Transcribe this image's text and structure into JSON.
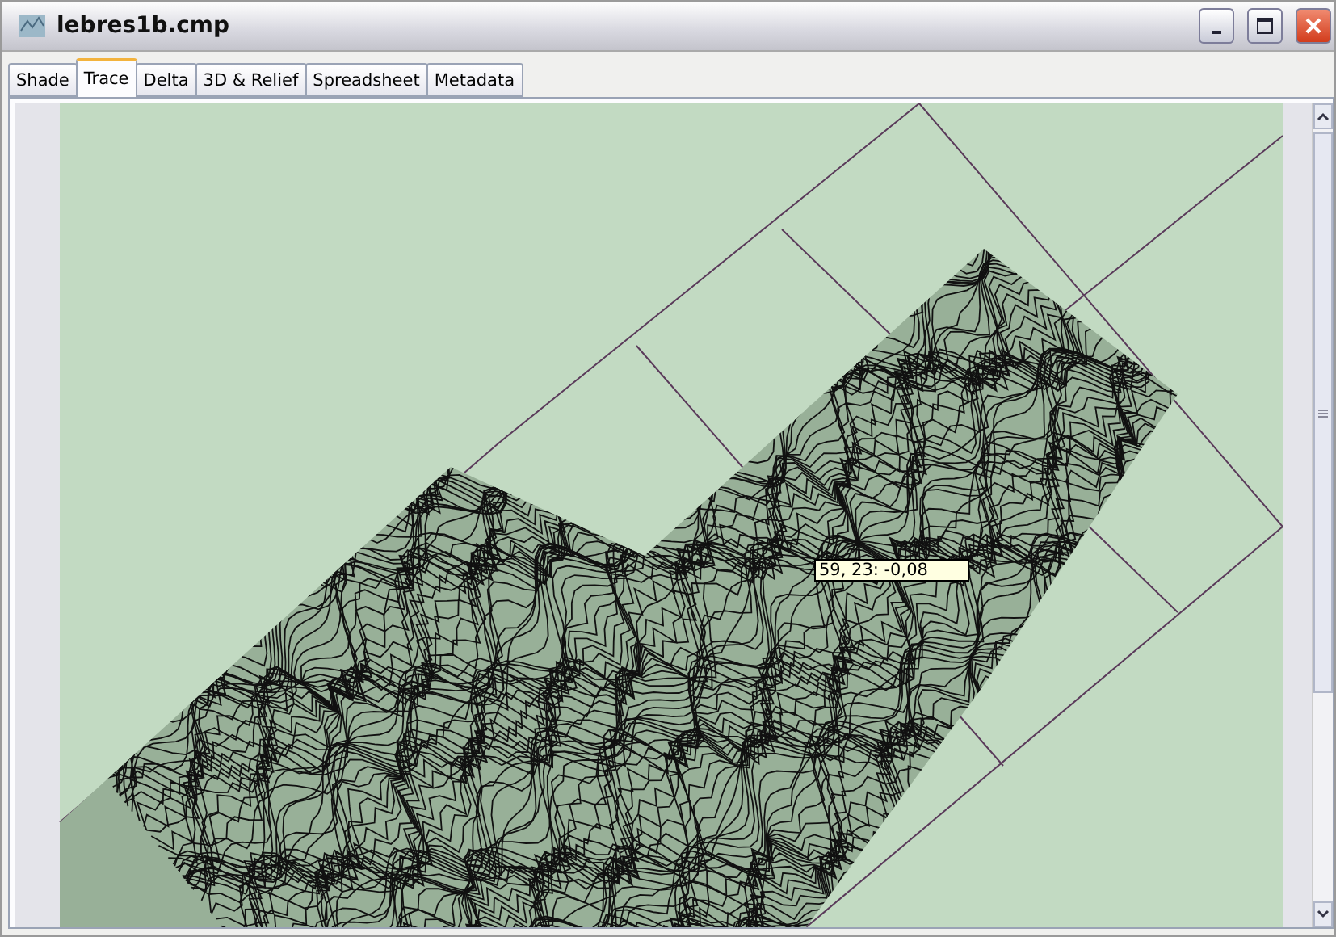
{
  "window": {
    "title": "lebres1b.cmp"
  },
  "tabs": [
    {
      "label": "Shade",
      "selected": false
    },
    {
      "label": "Trace",
      "selected": true
    },
    {
      "label": "Delta",
      "selected": false
    },
    {
      "label": "3D & Relief",
      "selected": false
    },
    {
      "label": "Spreadsheet",
      "selected": false
    },
    {
      "label": "Metadata",
      "selected": false
    }
  ],
  "plot": {
    "tooltip": "59, 23: -0,08"
  }
}
